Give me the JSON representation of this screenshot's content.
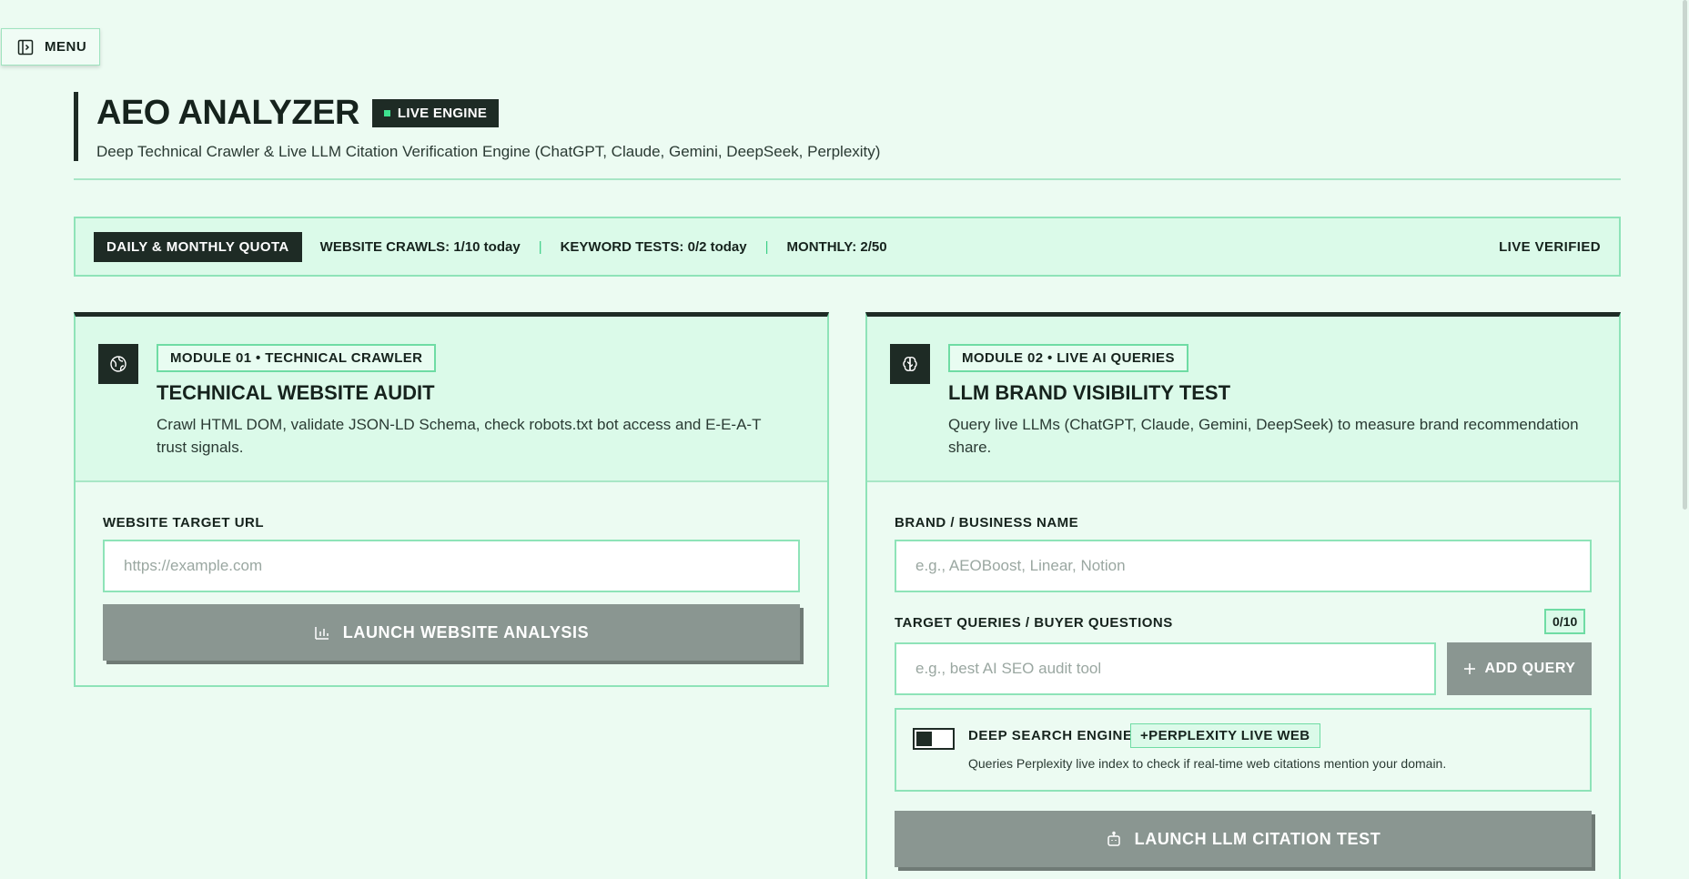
{
  "menu": {
    "label": "MENU"
  },
  "header": {
    "title": "AEO ANALYZER",
    "badge": "LIVE ENGINE",
    "subtitle": "Deep Technical Crawler & Live LLM Citation Verification Engine (ChatGPT, Claude, Gemini, DeepSeek, Perplexity)"
  },
  "quota": {
    "label": "DAILY & MONTHLY QUOTA",
    "website_crawls": "WEBSITE CRAWLS: 1/10 today",
    "keyword_tests": "KEYWORD TESTS: 0/2 today",
    "monthly": "MONTHLY: 2/50",
    "status": "LIVE VERIFIED"
  },
  "module1": {
    "icon": "globe-icon",
    "tag": "MODULE 01 • TECHNICAL CRAWLER",
    "title": "TECHNICAL WEBSITE AUDIT",
    "description": "Crawl HTML DOM, validate JSON-LD Schema, check robots.txt bot access and E-E-A-T trust signals.",
    "url_label": "WEBSITE TARGET URL",
    "url_placeholder": "https://example.com",
    "url_value": "",
    "launch_label": "LAUNCH WEBSITE ANALYSIS"
  },
  "module2": {
    "icon": "brain-icon",
    "tag": "MODULE 02 • LIVE AI QUERIES",
    "title": "LLM BRAND VISIBILITY TEST",
    "description": "Query live LLMs (ChatGPT, Claude, Gemini, DeepSeek) to measure brand recommendation share.",
    "brand_label": "BRAND / BUSINESS NAME",
    "brand_placeholder": "e.g., AEOBoost, Linear, Notion",
    "brand_value": "",
    "queries_label": "TARGET QUERIES / BUYER QUESTIONS",
    "queries_count": "0/10",
    "query_placeholder": "e.g., best AI SEO audit tool",
    "query_value": "",
    "add_query_label": "ADD QUERY",
    "deep_search": {
      "title": "DEEP SEARCH ENGINE",
      "tag": "+PERPLEXITY LIVE WEB",
      "description": "Queries Perplexity live index to check if real-time web citations mention your domain.",
      "enabled": false
    },
    "launch_label": "LAUNCH LLM CITATION TEST"
  },
  "colors": {
    "background": "#ecfbf2",
    "accent": "#3ee08f",
    "dark": "#1e2b25",
    "button_disabled": "#8a9691"
  }
}
